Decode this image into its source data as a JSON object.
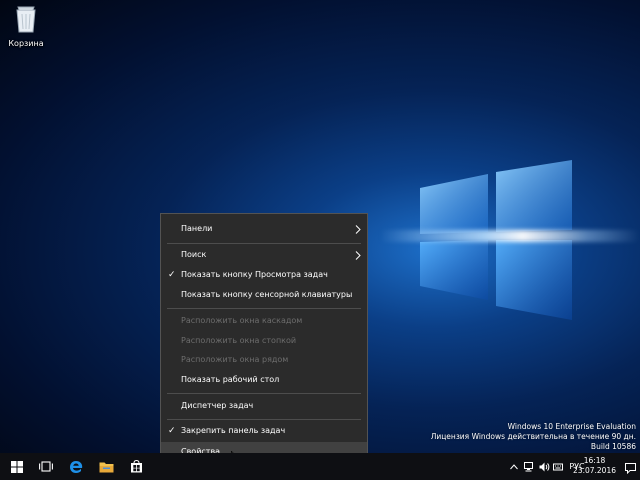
{
  "desktop": {
    "recycle_bin_label": "Корзина"
  },
  "context_menu": {
    "items": [
      {
        "label": "Панели"
      },
      {
        "label": "Поиск"
      },
      {
        "label": "Показать кнопку Просмотра задач"
      },
      {
        "label": "Показать кнопку сенсорной клавиатуры"
      },
      {
        "label": "Расположить окна каскадом"
      },
      {
        "label": "Расположить окна стопкой"
      },
      {
        "label": "Расположить окна рядом"
      },
      {
        "label": "Показать рабочий стол"
      },
      {
        "label": "Диспетчер задач"
      },
      {
        "label": "Закрепить панель задач"
      },
      {
        "label": "Свойства"
      }
    ]
  },
  "watermark": {
    "line1": "Windows 10 Enterprise Evaluation",
    "line2": "Лицензия Windows действительна в течение 90 дн.",
    "line3": "Build 10586"
  },
  "taskbar": {
    "language": "РУС",
    "time": "16:18",
    "date": "23.07.2016"
  },
  "colors": {
    "menu_bg": "#2b2b2b",
    "taskbar_bg": "#0e0f13",
    "edge_blue": "#1e90e8",
    "explorer_yellow": "#f2c14e"
  }
}
